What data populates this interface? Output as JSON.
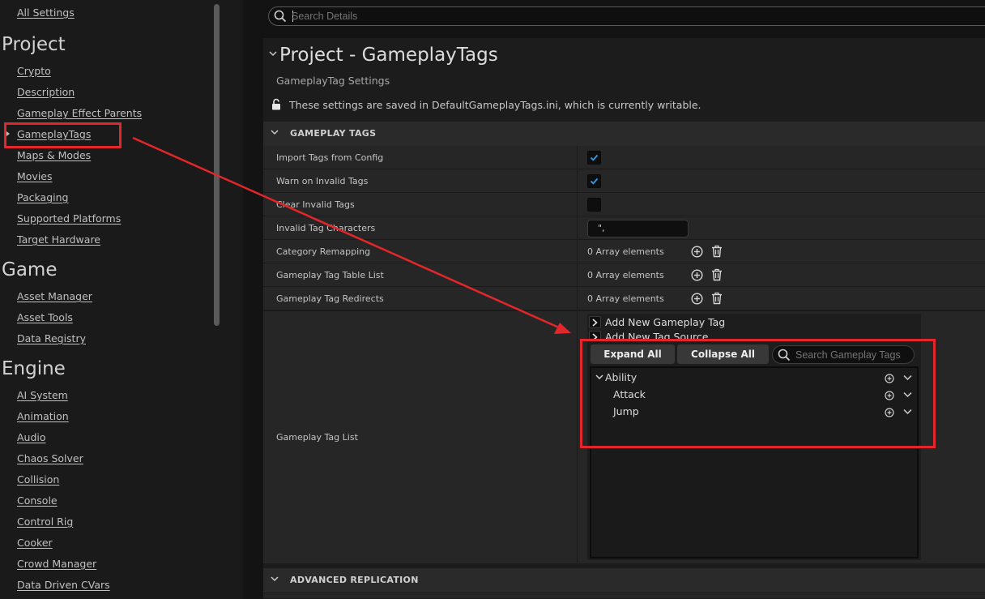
{
  "sidebar": {
    "top_link": "All Settings",
    "sections": [
      {
        "heading": "Project",
        "items": [
          "Crypto",
          "Description",
          "Gameplay Effect Parents",
          "GameplayTags",
          "Maps & Modes",
          "Movies",
          "Packaging",
          "Supported Platforms",
          "Target Hardware"
        ]
      },
      {
        "heading": "Game",
        "items": [
          "Asset Manager",
          "Asset Tools",
          "Data Registry"
        ]
      },
      {
        "heading": "Engine",
        "items": [
          "AI System",
          "Animation",
          "Audio",
          "Chaos Solver",
          "Collision",
          "Console",
          "Control Rig",
          "Cooker",
          "Crowd Manager",
          "Data Driven CVars"
        ]
      }
    ],
    "selected_item": "GameplayTags"
  },
  "search": {
    "placeholder": "Search Details"
  },
  "header": {
    "title": "Project - GameplayTags",
    "subtitle": "GameplayTag Settings",
    "save_notice": "These settings are saved in DefaultGameplayTags.ini, which is currently writable."
  },
  "categories": {
    "gameplay_tags": "GAMEPLAY TAGS",
    "advanced_replication": "ADVANCED REPLICATION"
  },
  "properties": {
    "import_tags": {
      "label": "Import Tags from Config",
      "checked": true
    },
    "warn_invalid": {
      "label": "Warn on Invalid Tags",
      "checked": true
    },
    "clear_invalid": {
      "label": "Clear Invalid Tags",
      "checked": false
    },
    "invalid_chars": {
      "label": "Invalid Tag Characters",
      "value": "\",",
      "text_value": "\","
    },
    "category_remapping": {
      "label": "Category Remapping",
      "value": "0 Array elements"
    },
    "tag_table_list": {
      "label": "Gameplay Tag Table List",
      "value": "0 Array elements"
    },
    "tag_redirects": {
      "label": "Gameplay Tag Redirects",
      "value": "0 Array elements"
    },
    "tag_list": {
      "label": "Gameplay Tag List"
    }
  },
  "tag_widget": {
    "add_new_tag": "Add New Gameplay Tag",
    "add_new_source": "Add New Tag Source",
    "expand_all": "Expand All",
    "collapse_all": "Collapse All",
    "search_placeholder": "Search Gameplay Tags",
    "tags": [
      {
        "name": "Ability",
        "level": 0,
        "expanded": true
      },
      {
        "name": "Attack",
        "level": 1
      },
      {
        "name": "Jump",
        "level": 1
      }
    ]
  },
  "colors": {
    "annotation": "#e3262b",
    "checkbox_check": "#2f9ee8"
  }
}
